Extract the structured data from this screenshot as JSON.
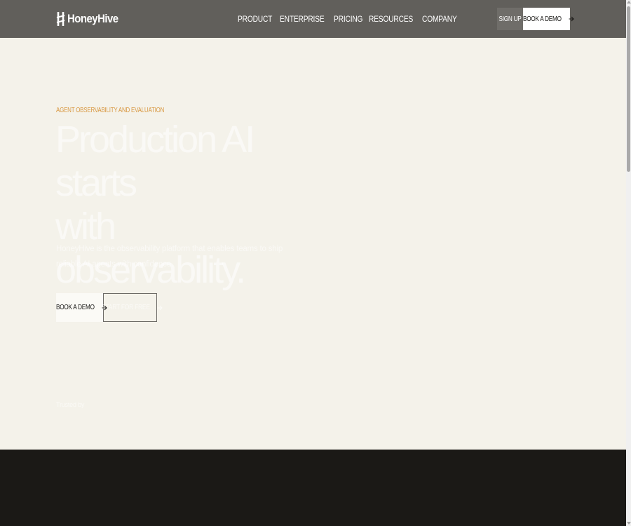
{
  "header": {
    "logo_text": "HoneyHive",
    "nav": [
      {
        "label": "PRODUCT"
      },
      {
        "label": "ENTERPRISE"
      },
      {
        "label": "PRICING"
      },
      {
        "label": "RESOURCES"
      },
      {
        "label": "COMPANY"
      }
    ],
    "signup_label": "SIGN UP",
    "demo_label": "BOOK A DEMO"
  },
  "hero": {
    "eyebrow": "AGENT OBSERVABILITY AND EVALUATION",
    "headline_line1": "Production AI starts",
    "headline_line2": "with observability.",
    "subtext": "HoneyHive is the observability platform that enables teams to ship reliable AI agents with confidence.",
    "primary_cta": "BOOK A DEMO",
    "secondary_cta": "START FOR FREE",
    "trusted_label": "Trusted by"
  },
  "colors": {
    "nav_bg": "#615f5b",
    "hero_bg": "#f4f2ea",
    "accent": "#d99a45",
    "dark_section": "#1b1916"
  },
  "icons": {
    "logo": "honeyhive-logo-icon",
    "cta_arrow": "arrow-right-icon"
  }
}
